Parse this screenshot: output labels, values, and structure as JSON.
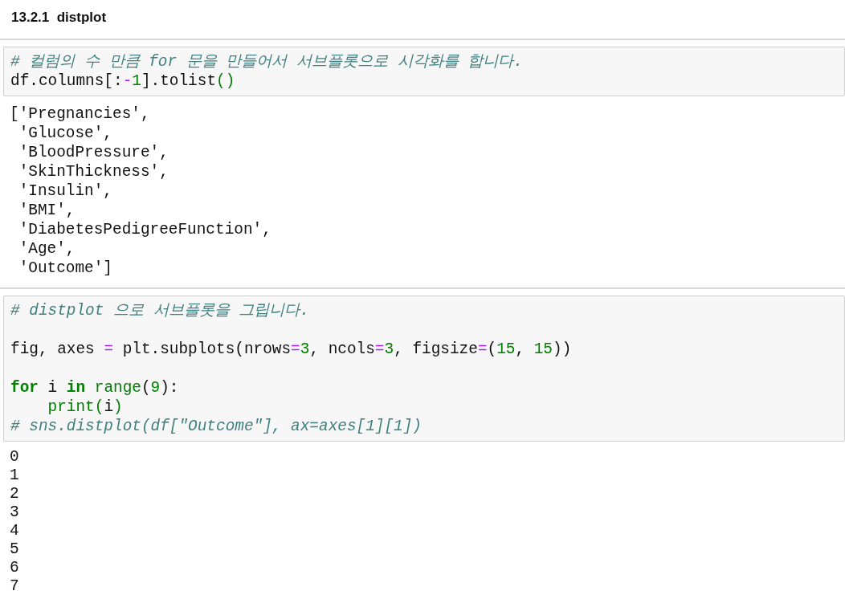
{
  "heading": {
    "number": "13.2.1",
    "title": "distplot"
  },
  "cells": [
    {
      "input": [
        {
          "lines": [
            {
              "tokens": [
                {
                  "kind": "c",
                  "text": "# 컬럼의 수 만큼 for 문을 만들어서 서브플롯으로 시각화를 합니다."
                }
              ]
            },
            {
              "tokens": [
                {
                  "kind": "p",
                  "text": "df.columns[:"
                },
                {
                  "kind": "o",
                  "text": "-"
                },
                {
                  "kind": "n",
                  "text": "1"
                },
                {
                  "kind": "p",
                  "text": "].tolist"
                },
                {
                  "kind": "b",
                  "text": "()"
                }
              ]
            }
          ]
        }
      ],
      "output": [
        "['Pregnancies',",
        " 'Glucose',",
        " 'BloodPressure',",
        " 'SkinThickness',",
        " 'Insulin',",
        " 'BMI',",
        " 'DiabetesPedigreeFunction',",
        " 'Age',",
        " 'Outcome']"
      ]
    },
    {
      "input": [
        {
          "lines": [
            {
              "tokens": [
                {
                  "kind": "c",
                  "text": "# distplot 으로 서브플롯을 그립니다."
                }
              ]
            }
          ]
        },
        {
          "lines": [
            {
              "tokens": [
                {
                  "kind": "p",
                  "text": "fig, axes "
                },
                {
                  "kind": "o",
                  "text": "="
                },
                {
                  "kind": "p",
                  "text": " plt.subplots(nrows"
                },
                {
                  "kind": "o",
                  "text": "="
                },
                {
                  "kind": "n",
                  "text": "3"
                },
                {
                  "kind": "p",
                  "text": ", ncols"
                },
                {
                  "kind": "o",
                  "text": "="
                },
                {
                  "kind": "n",
                  "text": "3"
                },
                {
                  "kind": "p",
                  "text": ", figsize"
                },
                {
                  "kind": "o",
                  "text": "="
                },
                {
                  "kind": "p",
                  "text": "("
                },
                {
                  "kind": "n",
                  "text": "15"
                },
                {
                  "kind": "p",
                  "text": ", "
                },
                {
                  "kind": "n",
                  "text": "15"
                },
                {
                  "kind": "p",
                  "text": "))"
                }
              ]
            }
          ]
        },
        {
          "lines": [
            {
              "tokens": [
                {
                  "kind": "k",
                  "text": "for"
                },
                {
                  "kind": "p",
                  "text": " i "
                },
                {
                  "kind": "k",
                  "text": "in"
                },
                {
                  "kind": "b",
                  "text": " range"
                },
                {
                  "kind": "p",
                  "text": "("
                },
                {
                  "kind": "n",
                  "text": "9"
                },
                {
                  "kind": "p",
                  "text": "):"
                }
              ]
            },
            {
              "tokens": [
                {
                  "kind": "b",
                  "text": "    print("
                },
                {
                  "kind": "p",
                  "text": "i"
                },
                {
                  "kind": "b",
                  "text": ")"
                }
              ]
            },
            {
              "tokens": [
                {
                  "kind": "c",
                  "text": "# sns.distplot(df[\"Outcome\"], ax=axes[1][1])"
                }
              ]
            }
          ]
        }
      ],
      "output": [
        "0",
        "1",
        "2",
        "3",
        "4",
        "5",
        "6",
        "7"
      ]
    }
  ]
}
